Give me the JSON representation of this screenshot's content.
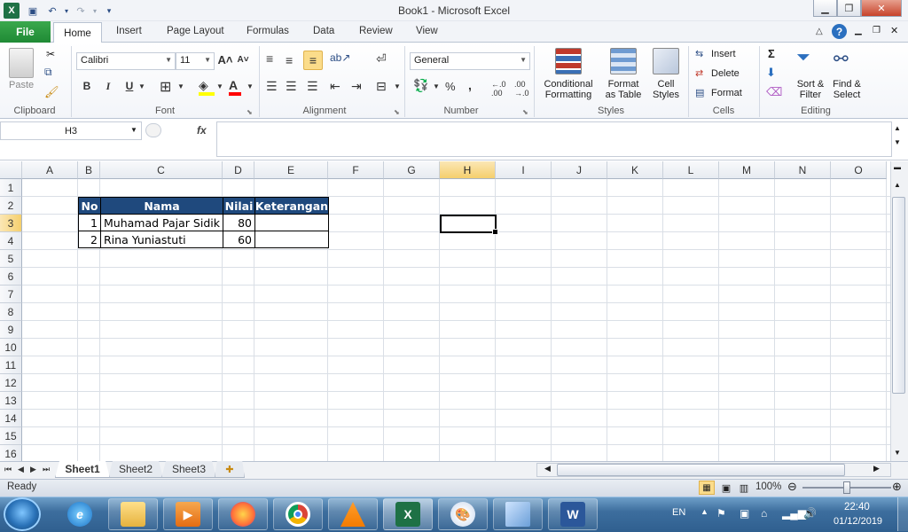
{
  "window": {
    "title": "Book1  -  Microsoft Excel"
  },
  "tabs": {
    "file": "File",
    "items": [
      "Home",
      "Insert",
      "Page Layout",
      "Formulas",
      "Data",
      "Review",
      "View"
    ]
  },
  "ribbon": {
    "clipboard": {
      "paste": "Paste",
      "label": "Clipboard"
    },
    "font": {
      "name": "Calibri",
      "size": "11",
      "label": "Font",
      "bold": "B",
      "italic": "I",
      "underline": "U"
    },
    "alignment": {
      "label": "Alignment"
    },
    "number": {
      "format": "General",
      "percent": "%",
      "comma": ",",
      "label": "Number"
    },
    "styles": {
      "cond_1": "Conditional",
      "cond_2": "Formatting",
      "table_1": "Format",
      "table_2": "as Table",
      "cell_1": "Cell",
      "cell_2": "Styles",
      "label": "Styles"
    },
    "cells": {
      "insert": "Insert",
      "delete": "Delete",
      "format": "Format",
      "label": "Cells"
    },
    "editing": {
      "sort_1": "Sort &",
      "sort_2": "Filter",
      "find_1": "Find &",
      "find_2": "Select",
      "label": "Editing",
      "sigma": "Σ"
    }
  },
  "formula_bar": {
    "name_box": "H3",
    "fx": "fx",
    "value": ""
  },
  "sheet": {
    "columns": [
      "A",
      "B",
      "C",
      "D",
      "E",
      "F",
      "G",
      "H",
      "I",
      "J",
      "K",
      "L",
      "M",
      "N",
      "O"
    ],
    "rows": [
      "1",
      "2",
      "3",
      "4",
      "5",
      "6",
      "7",
      "8",
      "9",
      "10",
      "11",
      "12",
      "13",
      "14",
      "15",
      "16"
    ],
    "selected_column": "H",
    "selected_row": "3",
    "table": {
      "headers": [
        "No",
        "Nama",
        "Nilai",
        "Keterangan"
      ],
      "rows": [
        [
          "1",
          "Muhamad Pajar Sidik",
          "80",
          ""
        ],
        [
          "2",
          "Rina Yuniastuti",
          "60",
          ""
        ]
      ]
    }
  },
  "sheet_tabs": [
    "Sheet1",
    "Sheet2",
    "Sheet3"
  ],
  "status": {
    "ready": "Ready",
    "zoom": "100%"
  },
  "taskbar": {
    "lang": "EN",
    "time": "22:40",
    "date": "01/12/2019"
  },
  "colors": {
    "header_fill": "#1f497d",
    "selection_header": "#f5cf6d",
    "file_tab": "#1f8a35"
  }
}
